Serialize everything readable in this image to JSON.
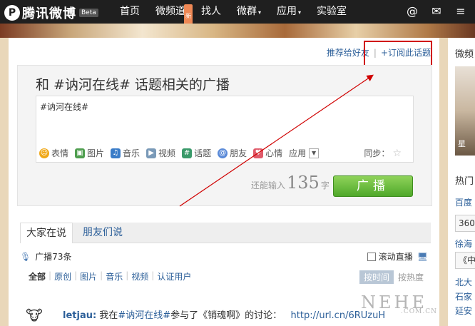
{
  "topbar": {
    "logo_text": "腾讯微博",
    "logo_badge": "Beta",
    "nav": [
      {
        "label": "首页"
      },
      {
        "label": "微频道",
        "badge": "新"
      },
      {
        "label": "找人"
      },
      {
        "label": "微群",
        "caret": "▾"
      },
      {
        "label": "应用",
        "caret": "▾"
      },
      {
        "label": "实验室"
      }
    ],
    "icons": [
      "at-icon",
      "mail-icon",
      "menu-icon"
    ]
  },
  "main": {
    "recommend_link": "推荐给好友",
    "subscribe_link": "+订阅此话题",
    "compose": {
      "title": "和 #讷河在线# 话题相关的广播",
      "text": "#讷河在线#",
      "tools": [
        {
          "icon": "emoji-icon",
          "label": "表情",
          "color": "#f0a818"
        },
        {
          "icon": "image-icon",
          "label": "图片",
          "color": "#4f9e4f"
        },
        {
          "icon": "music-icon",
          "label": "音乐",
          "color": "#3a7cc8"
        },
        {
          "icon": "video-icon",
          "label": "视频",
          "color": "#7a9ab8"
        },
        {
          "icon": "topic-icon",
          "label": "话题",
          "color": "#3a9a6a"
        },
        {
          "icon": "friend-icon",
          "label": "朋友",
          "color": "#5a8ad8"
        },
        {
          "icon": "heart-icon",
          "label": "心情",
          "color": "#e05a6a"
        }
      ],
      "apps_label": "应用",
      "sync_label": "同步：",
      "counter_prefix": "还能输入",
      "counter_value": "135",
      "counter_suffix": "字",
      "submit_label": "广播"
    },
    "tabs": {
      "active": "大家在说",
      "inactive": "朋友们说"
    },
    "stats": {
      "count_label": "广播73条",
      "live_label": "滚动直播"
    },
    "filters": [
      "全部",
      "原创",
      "图片",
      "音乐",
      "视频",
      "认证用户"
    ],
    "sort": {
      "by_time": "按时间",
      "by_hot": "按热度"
    },
    "feed": {
      "user": "letjau:",
      "text_1": " 我在",
      "topic": "#讷河在线#",
      "text_2": "参与了《销魂啊》的讨论：",
      "url": "http://url.cn/6RUzuH"
    }
  },
  "sidebar": {
    "title": "微频",
    "avatar_label": "星",
    "hot_title": "热门",
    "items": [
      "百度",
      "360",
      "徐海",
      "《中",
      "北大",
      "石家",
      "延安"
    ]
  },
  "watermark": {
    "main": "NEHE",
    "sub": ".COM.CN"
  }
}
